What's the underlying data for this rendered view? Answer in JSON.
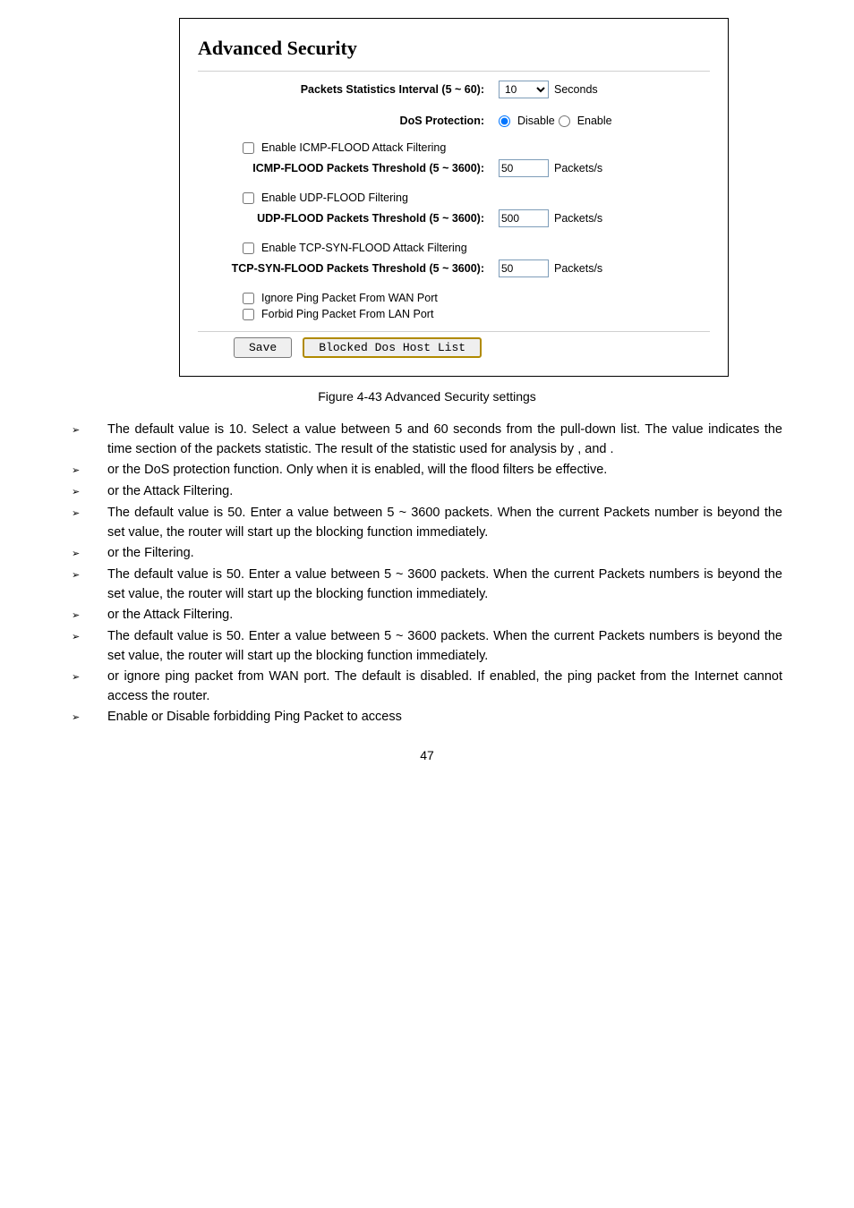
{
  "panel": {
    "title": "Advanced Security",
    "rows": {
      "stats_label": "Packets Statistics Interval (5 ~ 60):",
      "stats_value": "10",
      "stats_unit": "Seconds",
      "dos_label": "DoS Protection:",
      "dos_disable": "Disable",
      "dos_enable": "Enable",
      "icmp_enable": "Enable ICMP-FLOOD Attack Filtering",
      "icmp_thresh_label": "ICMP-FLOOD Packets Threshold (5 ~ 3600):",
      "icmp_thresh_value": "50",
      "pkts_s": "Packets/s",
      "udp_enable": "Enable UDP-FLOOD Filtering",
      "udp_thresh_label": "UDP-FLOOD Packets Threshold (5 ~ 3600):",
      "udp_thresh_value": "500",
      "tcp_enable": "Enable TCP-SYN-FLOOD Attack Filtering",
      "tcp_thresh_label": "TCP-SYN-FLOOD Packets Threshold (5 ~ 3600):",
      "tcp_thresh_value": "50",
      "ignore_wan": "Ignore Ping Packet From WAN Port",
      "forbid_lan": "Forbid Ping Packet From LAN Port",
      "save": "Save",
      "blocked": "Blocked Dos Host List"
    }
  },
  "caption": "Figure 4-43 Advanced Security settings",
  "bullets": {
    "b1": "The default value is 10. Select a value between 5 and 60 seconds from the pull-down list. The value indicates the time section of the packets statistic. The result of the statistic used for analysis by , and .",
    "b2": "or the DoS protection function. Only when it is enabled, will the flood filters be effective.",
    "b3": "or the Attack Filtering.",
    "b4": "The default value is 50. Enter a value between 5 ~ 3600 packets. When the current Packets number is beyond the set value, the router will start up the blocking function immediately.",
    "b5": "or the Filtering.",
    "b6": "The default value is 50. Enter a value between 5 ~ 3600 packets. When the current Packets numbers is beyond the set value, the router will start up the blocking function immediately.",
    "b7": "or the Attack Filtering.",
    "b8": "The default value is 50. Enter a value between 5 ~ 3600 packets. When the current Packets numbers is beyond the set value, the router will start up the blocking function immediately.",
    "b9": "or ignore ping packet from WAN port. The default is disabled. If enabled, the ping packet from the Internet cannot access the router.",
    "b10": "Enable or Disable forbidding Ping Packet to access"
  },
  "pagenum": "47"
}
